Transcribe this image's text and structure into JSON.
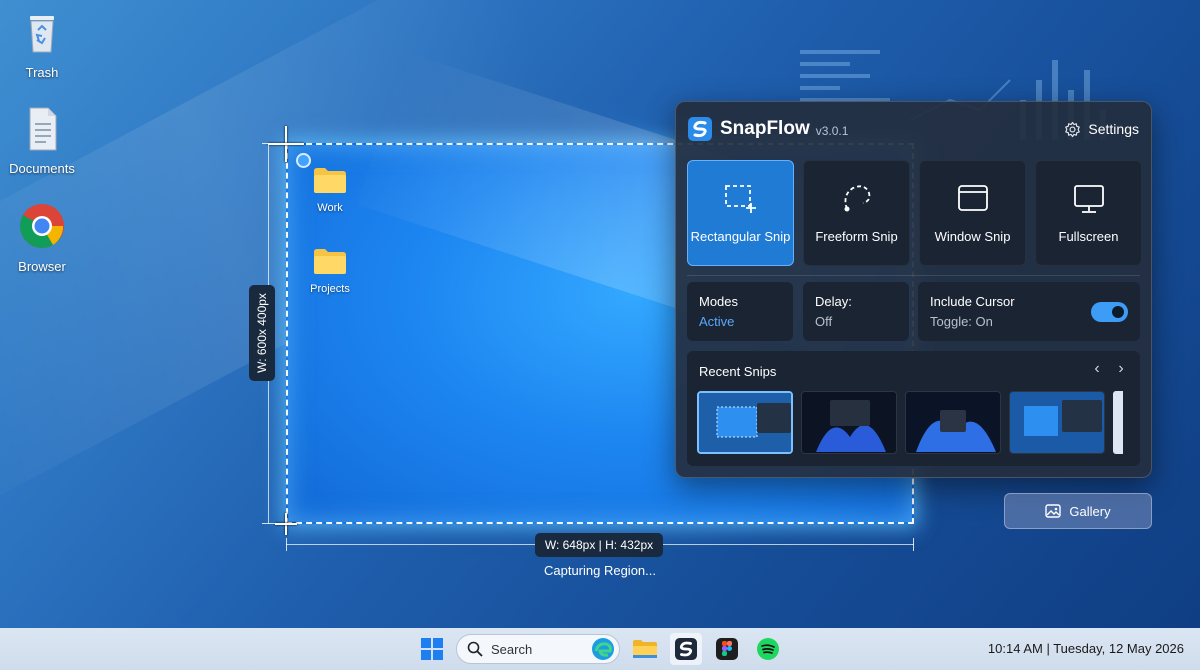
{
  "desktop": {
    "icons": [
      {
        "label": "Trash",
        "icon": "recycle-bin-icon"
      },
      {
        "label": "Documents",
        "icon": "document-icon"
      },
      {
        "label": "Browser",
        "icon": "chrome-icon"
      }
    ]
  },
  "capture": {
    "folders": [
      {
        "label": "Work",
        "icon": "folder-icon"
      },
      {
        "label": "Projects",
        "icon": "folder-icon"
      }
    ],
    "dimension_vertical": "W: 600x 400px",
    "dimension_horizontal": "W: 648px | H: 432px",
    "status": "Capturing Region..."
  },
  "panel": {
    "app_name": "SnapFlow",
    "version": "v3.0.1",
    "settings_label": "Settings",
    "modes": [
      {
        "label": "Rectangular Snip",
        "icon": "rectangular-snip-icon",
        "active": true
      },
      {
        "label": "Freeform Snip",
        "icon": "freeform-snip-icon",
        "active": false
      },
      {
        "label": "Window Snip",
        "icon": "window-snip-icon",
        "active": false
      },
      {
        "label": "Fullscreen",
        "icon": "fullscreen-icon",
        "active": false
      }
    ],
    "options": {
      "modes_title": "Modes",
      "modes_value": "Active",
      "delay_title": "Delay:",
      "delay_value": "Off",
      "cursor_title": "Include Cursor",
      "cursor_value": "Toggle: On",
      "cursor_on": true
    },
    "recent": {
      "title": "Recent Snips",
      "prev_icon": "chevron-left-icon",
      "next_icon": "chevron-right-icon"
    }
  },
  "gallery_label": "Gallery",
  "taskbar": {
    "search_placeholder": "Search",
    "clock": "10:14 AM | Tuesday, 12 May 2026",
    "apps": [
      "start-icon",
      "edge-icon",
      "file-explorer-icon",
      "snapflow-icon",
      "figma-icon",
      "spotify-icon"
    ]
  },
  "colors": {
    "accent": "#1f7bd4",
    "panel_bg": "#242e3e",
    "toggle_on": "#3d9cf5"
  }
}
